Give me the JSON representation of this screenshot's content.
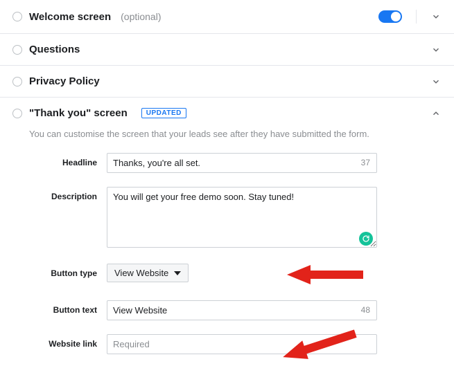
{
  "sections": {
    "welcome": {
      "title": "Welcome screen",
      "optional": "(optional)"
    },
    "questions": {
      "title": "Questions"
    },
    "privacy": {
      "title": "Privacy Policy"
    },
    "thankyou": {
      "title": "\"Thank you\" screen",
      "badge": "UPDATED",
      "description": "You can customise the screen that your leads see after they have submitted the form."
    }
  },
  "form": {
    "headline": {
      "label": "Headline",
      "value": "Thanks, you're all set.",
      "count": "37"
    },
    "description": {
      "label": "Description",
      "value": "You will get your free demo soon. Stay tuned!"
    },
    "button_type": {
      "label": "Button type",
      "selected": "View Website"
    },
    "button_text": {
      "label": "Button text",
      "value": "View Website",
      "count": "48"
    },
    "website_link": {
      "label": "Website link",
      "placeholder": "Required"
    }
  }
}
